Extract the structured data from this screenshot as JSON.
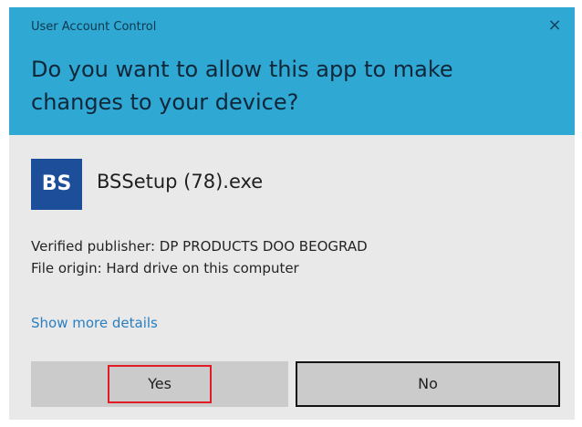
{
  "window": {
    "title": "User Account Control",
    "close_symbol": "×"
  },
  "prompt": {
    "question": "Do you want to allow this app to make changes to your device?"
  },
  "app": {
    "icon_text": "BS",
    "name": "BSSetup (78).exe"
  },
  "details": {
    "publisher": "Verified publisher: DP PRODUCTS DOO BEOGRAD",
    "origin": "File origin: Hard drive on this computer",
    "show_more": "Show more details"
  },
  "buttons": {
    "yes": "Yes",
    "no": "No"
  },
  "colors": {
    "header": "#2fa8d3",
    "body": "#e9e9e9",
    "icon_bg": "#1d4e9a",
    "link": "#2a7fc0",
    "highlight": "#e01b24"
  }
}
